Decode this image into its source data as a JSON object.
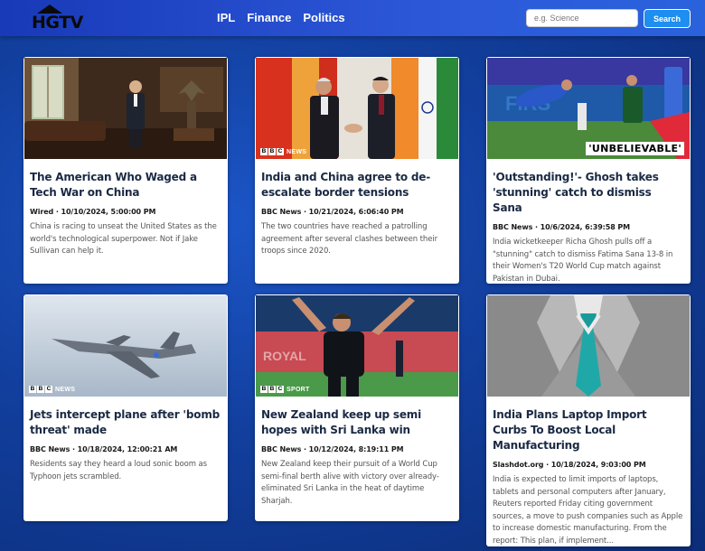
{
  "header": {
    "logo_text": "HGTV",
    "nav": [
      "IPL",
      "Finance",
      "Politics"
    ],
    "search": {
      "placeholder": "e.g. Science",
      "value": "",
      "button_label": "Search"
    }
  },
  "colors": {
    "background": "#123f9e",
    "navbar": "#2c58d8",
    "search_button": "#1e8ef0",
    "card": "#ffffff",
    "title": "#1a2a44"
  },
  "cards": [
    {
      "title": "The American Who Waged a Tech War on China",
      "meta": "Wired · 10/10/2024, 5:00:00 PM",
      "desc": "China is racing to unseat the United States as the world's technological superpower. Not if Jake Sullivan can help it.",
      "image": "man-in-office-with-eagle-statue"
    },
    {
      "title": "India and China agree to de-escalate border tensions",
      "meta": "BBC News · 10/21/2024, 6:06:40 PM",
      "desc": "The two countries have reached a patrolling agreement after several clashes between their troops since 2020.",
      "image": "leaders-handshake-flags",
      "badge": "NEWS"
    },
    {
      "title": "'Outstanding!'- Ghosh takes 'stunning' catch to dismiss Sana",
      "meta": "BBC News · 10/6/2024, 6:39:58 PM",
      "desc": "India wicketkeeper Richa Ghosh pulls off a \"stunning\" catch to dismiss Fatima Sana 13-8 in their Women's T20 World Cup match against Pakistan in Dubai.",
      "image": "cricket-diving-catch",
      "overlay": "'UNBELIEVABLE'"
    },
    {
      "title": "Jets intercept plane after 'bomb threat' made",
      "meta": "BBC News · 10/18/2024, 12:00:21 AM",
      "desc": "Residents say they heard a loud sonic boom as Typhoon jets scrambled.",
      "image": "typhoon-jet-in-sky",
      "badge": "NEWS"
    },
    {
      "title": "New Zealand keep up semi hopes with Sri Lanka win",
      "meta": "BBC News · 10/12/2024, 8:19:11 PM",
      "desc": "New Zealand keep their pursuit of a World Cup semi-final berth alive with victory over already-eliminated Sri Lanka in the heat of daytime Sharjah.",
      "image": "cricketer-celebrating",
      "badge": "SPORT"
    },
    {
      "title": "India Plans Laptop Import Curbs To Boost Local Manufacturing",
      "meta": "Slashdot.org · 10/18/2024, 9:03:00 PM",
      "desc": "India is expected to limit imports of laptops, tablets and personal computers after January, Reuters reported Friday citing government sources, a move to push companies such as Apple to increase domestic manufacturing. From the report: This plan, if implement...",
      "image": "suit-and-teal-tie"
    }
  ]
}
